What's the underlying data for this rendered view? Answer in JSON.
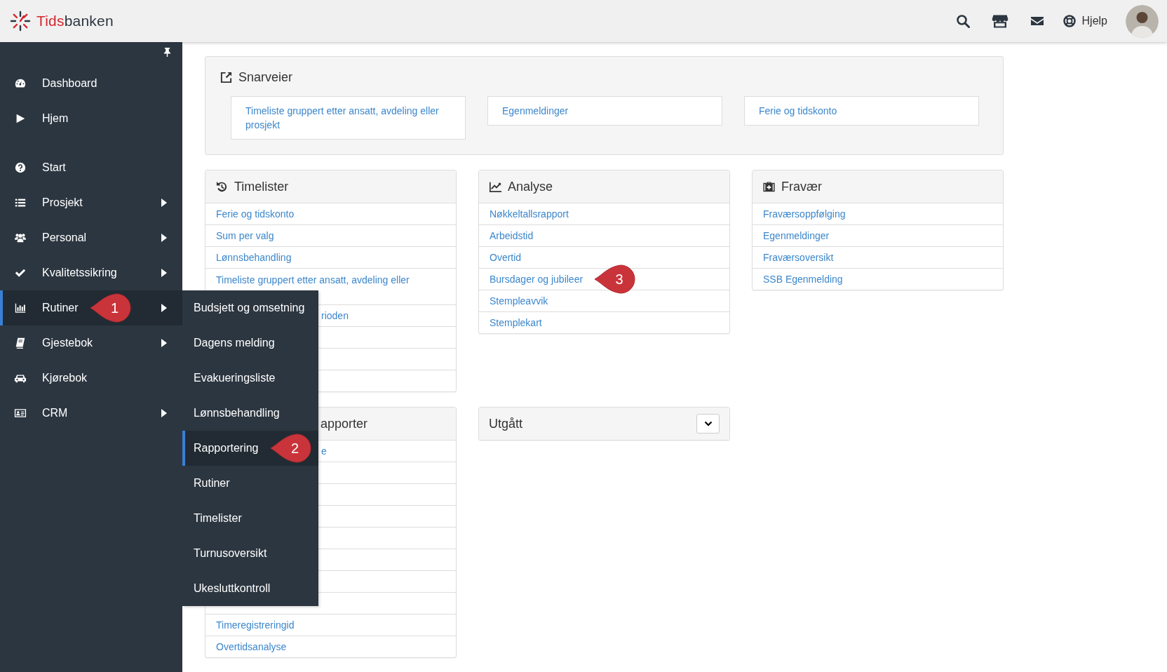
{
  "topbar": {
    "brand": {
      "prefix": "Tids",
      "suffix": "banken"
    },
    "help": "Hjelp"
  },
  "sidebar": {
    "groups": [
      [
        {
          "label": "Dashboard",
          "has_submenu": false,
          "selected": false
        },
        {
          "label": "Hjem",
          "has_submenu": false,
          "selected": false
        }
      ],
      [
        {
          "label": "Start",
          "has_submenu": false,
          "selected": false
        },
        {
          "label": "Prosjekt",
          "has_submenu": true,
          "selected": false,
          "expanded": false
        },
        {
          "label": "Personal",
          "has_submenu": true,
          "selected": false,
          "expanded": false
        },
        {
          "label": "Kvalitetssikring",
          "has_submenu": true,
          "selected": false,
          "expanded": false
        },
        {
          "label": "Rutiner",
          "has_submenu": true,
          "selected": true,
          "expanded": true,
          "callout": "1",
          "submenu": [
            {
              "label": "Budsjett og omsetning",
              "selected": false
            },
            {
              "label": "Dagens melding",
              "selected": false
            },
            {
              "label": "Evakueringsliste",
              "selected": false
            },
            {
              "label": "Lønnsbehandling",
              "selected": false
            },
            {
              "label": "Rapportering",
              "selected": true,
              "callout": "2"
            },
            {
              "label": "Rutiner",
              "selected": false
            },
            {
              "label": "Timelister",
              "selected": false
            },
            {
              "label": "Turnusoversikt",
              "selected": false
            },
            {
              "label": "Ukesluttkontroll",
              "selected": false
            }
          ]
        },
        {
          "label": "Gjestebok",
          "has_submenu": true,
          "selected": false,
          "expanded": false
        },
        {
          "label": "Kjørebok",
          "has_submenu": false,
          "selected": false
        },
        {
          "label": "CRM",
          "has_submenu": true,
          "selected": false,
          "expanded": false
        }
      ]
    ]
  },
  "shortcuts": {
    "title": "Snarveier",
    "links": [
      "Timeliste gruppert etter ansatt, avdeling eller prosjekt",
      "Egenmeldinger",
      "Ferie og tidskonto"
    ]
  },
  "panel_rows": [
    [
      {
        "title": "Timelister",
        "kind": "list",
        "rows": [
          {
            "kind": "link",
            "text": "Ferie og tidskonto"
          },
          {
            "kind": "link",
            "text": "Sum per valg"
          },
          {
            "kind": "link",
            "text": "Lønnsbehandling"
          },
          {
            "kind": "wrapped",
            "text": "Timeliste gruppert etter ansatt, avdeling eller"
          },
          {
            "kind": "tail",
            "text": "rioden"
          },
          {
            "kind": "blank"
          },
          {
            "kind": "blank"
          },
          {
            "kind": "blank"
          }
        ]
      },
      {
        "title": "Analyse",
        "kind": "list",
        "rows": [
          {
            "kind": "link",
            "text": "Nøkkeltallsrapport"
          },
          {
            "kind": "link",
            "text": "Arbeidstid"
          },
          {
            "kind": "link",
            "text": "Overtid"
          },
          {
            "kind": "link",
            "text": "Bursdager og jubileer",
            "callout": "3"
          },
          {
            "kind": "link",
            "text": "Stempleavvik"
          },
          {
            "kind": "link",
            "text": "Stemplekart"
          }
        ]
      },
      {
        "title": "Fravær",
        "kind": "list",
        "rows": [
          {
            "kind": "link",
            "text": "Fraværsoppfølging"
          },
          {
            "kind": "link",
            "text": "Egenmeldinger"
          },
          {
            "kind": "link",
            "text": "Fraværsoversikt"
          },
          {
            "kind": "link",
            "text": "SSB Egenmelding"
          }
        ]
      }
    ],
    [
      {
        "title": "apporter",
        "kind": "tail",
        "rows": [
          {
            "kind": "tail",
            "text": "e"
          },
          {
            "kind": "blank"
          },
          {
            "kind": "blank"
          },
          {
            "kind": "blank"
          },
          {
            "kind": "blank"
          },
          {
            "kind": "blank"
          },
          {
            "kind": "blank"
          },
          {
            "kind": "blank"
          },
          {
            "kind": "link",
            "text": "Timeregistreringid"
          },
          {
            "kind": "link",
            "text": "Overtidsanalyse"
          }
        ]
      },
      {
        "title": "Utgått",
        "kind": "collapsed"
      }
    ]
  ]
}
